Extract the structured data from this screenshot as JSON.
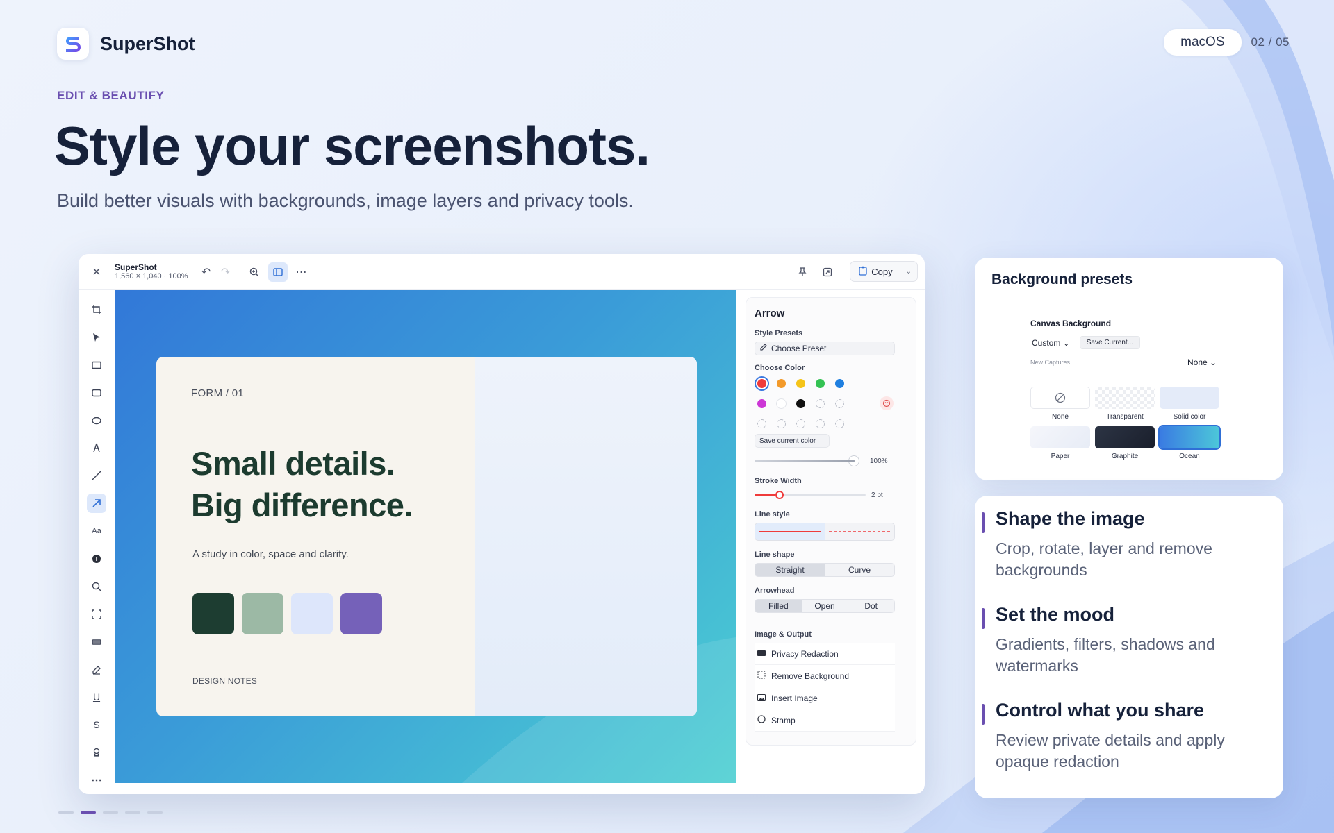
{
  "brand": {
    "name": "SuperShot"
  },
  "platform": "macOS",
  "page_indicator": "02 / 05",
  "eyebrow": "EDIT & BEAUTIFY",
  "headline": "Style your screenshots.",
  "subheadline": "Build better visuals with backgrounds, image layers and privacy tools.",
  "window": {
    "app_name": "SuperShot",
    "dimensions": "1,560 × 1,040",
    "zoom": "100%",
    "copy_label": "Copy"
  },
  "mockup_card": {
    "label": "FORM / 01",
    "title_line1": "Small details.",
    "title_line2": "Big difference.",
    "subtitle": "A study in color, space and clarity.",
    "footer": "DESIGN NOTES",
    "swatch_colors": [
      "#1d3d31",
      "#9cb9a5",
      "#dde6fb",
      "#7561b9"
    ]
  },
  "panel": {
    "title": "Arrow",
    "style_presets_label": "Style Presets",
    "choose_preset": "Choose Preset",
    "choose_color_label": "Choose Color",
    "save_color": "Save current color",
    "opacity": "100%",
    "stroke_width_label": "Stroke Width",
    "stroke_width_value": "2 pt",
    "line_style_label": "Line style",
    "line_shape_label": "Line shape",
    "line_shape_options": [
      "Straight",
      "Curve"
    ],
    "arrowhead_label": "Arrowhead",
    "arrowhead_options": [
      "Filled",
      "Open",
      "Dot"
    ],
    "image_output_label": "Image & Output",
    "image_output_items": [
      "Privacy Redaction",
      "Remove Background",
      "Insert Image",
      "Stamp"
    ]
  },
  "color_palette": [
    "#ef3b3b",
    "#f39a2a",
    "#f5c419",
    "#34c253",
    "#1f7fe0",
    "#cc37d6",
    "#ffffff",
    "#111111"
  ],
  "background_presets": {
    "title": "Background presets",
    "canvas_background": "Canvas Background",
    "custom": "Custom",
    "save_current": "Save Current...",
    "new_captures": "New Captures",
    "none_select": "None",
    "presets": [
      "None",
      "Transparent",
      "Solid color",
      "Paper",
      "Graphite",
      "Ocean"
    ]
  },
  "features": [
    {
      "title": "Shape the image",
      "desc": "Crop, rotate, layer and remove backgrounds"
    },
    {
      "title": "Set the mood",
      "desc": "Gradients, filters, shadows and watermarks"
    },
    {
      "title": "Control what you share",
      "desc": "Review private details and apply opaque redaction"
    }
  ]
}
